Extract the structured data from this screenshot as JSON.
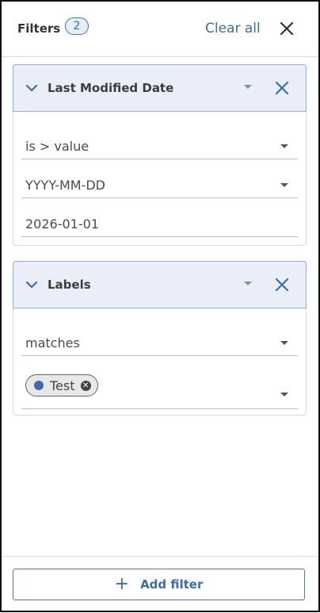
{
  "header": {
    "title": "Filters",
    "count": "2",
    "clear_label": "Clear all"
  },
  "filters": [
    {
      "name": "Last Modified Date",
      "operator": "is > value",
      "format": "YYYY-MM-DD",
      "value": "2026-01-01"
    },
    {
      "name": "Labels",
      "operator": "matches",
      "chip_label": "Test",
      "chip_color": "#4466aa"
    }
  ],
  "footer": {
    "add_label": "Add filter"
  },
  "colors": {
    "accent": "#3a6ea8",
    "card_header_bg": "#e9eef9"
  },
  "icons": {
    "close": "close-icon",
    "collapse": "chevron-down-icon",
    "dropdown": "dropdown-caret-icon",
    "add": "plus-icon"
  }
}
